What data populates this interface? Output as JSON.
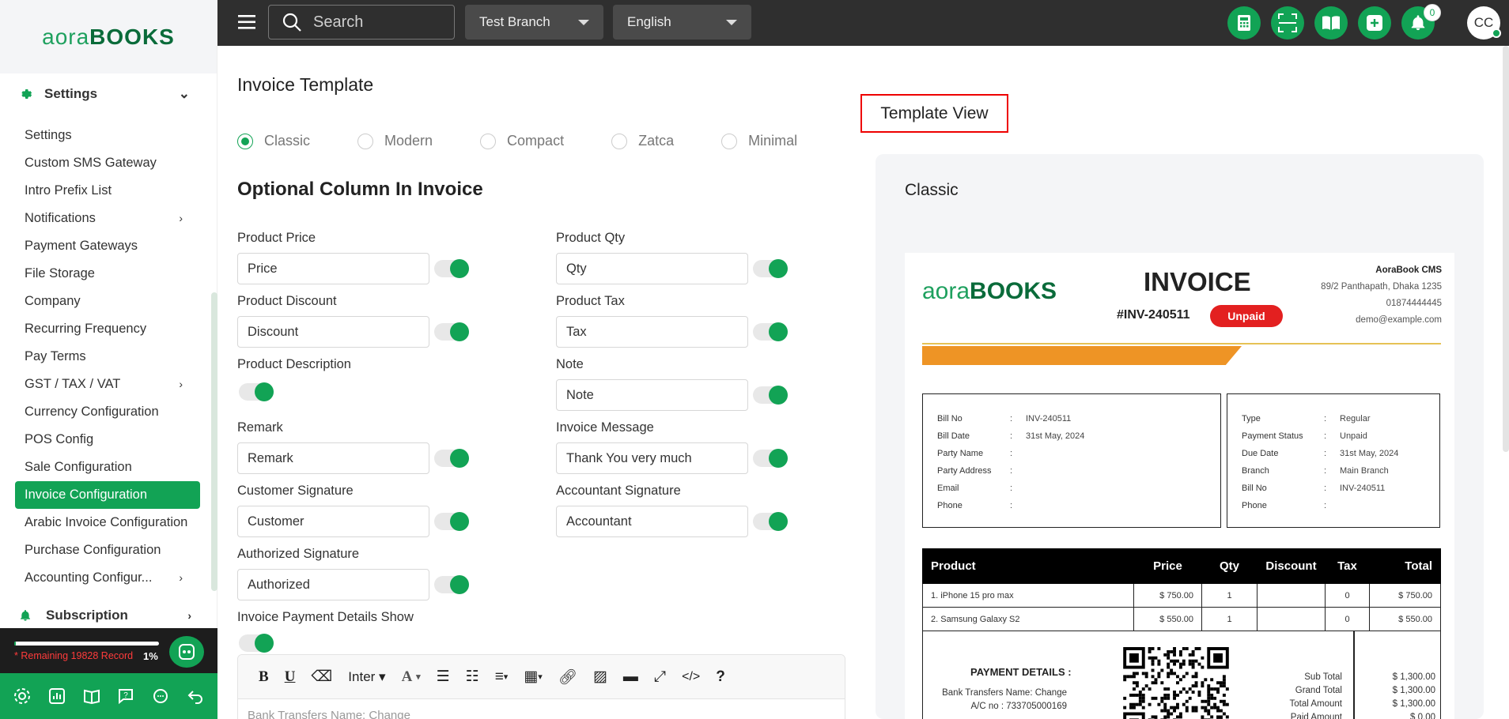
{
  "brand": {
    "name_part1": "aora",
    "name_part2": "BOOKS"
  },
  "sidebar": {
    "settings_header": "Settings",
    "items": [
      {
        "label": "Settings"
      },
      {
        "label": "Custom SMS Gateway"
      },
      {
        "label": "Intro Prefix List"
      },
      {
        "label": "Notifications",
        "has_children": true
      },
      {
        "label": "Payment Gateways"
      },
      {
        "label": "File Storage"
      },
      {
        "label": "Company"
      },
      {
        "label": "Recurring Frequency"
      },
      {
        "label": "Pay Terms"
      },
      {
        "label": "GST / TAX / VAT",
        "has_children": true
      },
      {
        "label": "Currency Configuration"
      },
      {
        "label": "POS Config"
      },
      {
        "label": "Sale Configuration"
      },
      {
        "label": "Invoice Configuration",
        "active": true
      },
      {
        "label": "Arabic Invoice Configuration"
      },
      {
        "label": "Purchase Configuration"
      },
      {
        "label": "Accounting Configur...",
        "has_children": true
      }
    ],
    "subscription_label": "Subscription",
    "remaining_text": "* Remaining 19828 Record",
    "usage_percent": "1%",
    "usage_fraction": 0.01
  },
  "topbar": {
    "search_placeholder": "Search",
    "branch": "Test Branch",
    "language": "English",
    "notification_count": "0",
    "avatar_initials": "CC"
  },
  "main": {
    "title": "Invoice Template",
    "templates": [
      {
        "label": "Classic",
        "selected": true
      },
      {
        "label": "Modern"
      },
      {
        "label": "Compact"
      },
      {
        "label": "Zatca"
      },
      {
        "label": "Minimal"
      }
    ],
    "section_title": "Optional Column In Invoice",
    "fields": {
      "product_price": {
        "label": "Product Price",
        "value": "Price",
        "enabled": true
      },
      "product_qty": {
        "label": "Product Qty",
        "value": "Qty",
        "enabled": true
      },
      "product_discount": {
        "label": "Product Discount",
        "value": "Discount",
        "enabled": true
      },
      "product_tax": {
        "label": "Product Tax",
        "value": "Tax",
        "enabled": true
      },
      "product_description": {
        "label": "Product Description",
        "enabled": true
      },
      "note": {
        "label": "Note",
        "value": "Note",
        "enabled": true
      },
      "remark": {
        "label": "Remark",
        "value": "Remark",
        "enabled": true
      },
      "invoice_message": {
        "label": "Invoice Message",
        "value": "Thank You very much",
        "enabled": true
      },
      "customer_signature": {
        "label": "Customer Signature",
        "value": "Customer",
        "enabled": true
      },
      "accountant_signature": {
        "label": "Accountant Signature",
        "value": "Accountant",
        "enabled": true
      },
      "authorized_signature": {
        "label": "Authorized Signature",
        "value": "Authorized",
        "enabled": true
      },
      "payment_details_show": {
        "label": "Invoice Payment Details Show",
        "enabled": true
      }
    },
    "editor": {
      "font_label": "Inter",
      "body_preview": "Bank Transfers Name: Change"
    }
  },
  "template_view": {
    "label": "Template View",
    "selected_name": "Classic",
    "invoice": {
      "title": "INVOICE",
      "number": "#INV-240511",
      "status": "Unpaid",
      "company": {
        "name": "AoraBook CMS",
        "address": "89/2 Panthapath, Dhaka 1235",
        "phone": "01874444445",
        "email": "demo@example.com"
      },
      "bill_info": [
        {
          "k": "Bill No",
          "v": "INV-240511"
        },
        {
          "k": "Bill Date",
          "v": "31st May, 2024"
        },
        {
          "k": "Party Name",
          "v": ""
        },
        {
          "k": "Party Address",
          "v": ""
        },
        {
          "k": "Email",
          "v": ""
        },
        {
          "k": "Phone",
          "v": ""
        }
      ],
      "type_info": [
        {
          "k": "Type",
          "v": "Regular"
        },
        {
          "k": "Payment Status",
          "v": "Unpaid"
        },
        {
          "k": "Due Date",
          "v": "31st May, 2024"
        },
        {
          "k": "Branch",
          "v": "Main Branch"
        },
        {
          "k": "Bill No",
          "v": "INV-240511"
        },
        {
          "k": "Phone",
          "v": ""
        }
      ],
      "columns": [
        "Product",
        "Price",
        "Qty",
        "Discount",
        "Tax",
        "Total"
      ],
      "rows": [
        {
          "product": "1. iPhone 15 pro max",
          "price": "$ 750.00",
          "qty": "1",
          "discount": "",
          "tax": "0",
          "total": "$ 750.00"
        },
        {
          "product": "2. Samsung Galaxy S2",
          "price": "$ 550.00",
          "qty": "1",
          "discount": "",
          "tax": "0",
          "total": "$ 550.00"
        }
      ],
      "payment_title": "PAYMENT DETAILS :",
      "payment_lines": [
        "Bank Transfers Name: Change",
        "A/C no : 733705000169"
      ],
      "totals": [
        {
          "k": "Sub Total",
          "v": "$ 1,300.00"
        },
        {
          "k": "Grand Total",
          "v": "$ 1,300.00"
        },
        {
          "k": "Total Amount",
          "v": "$ 1,300.00"
        },
        {
          "k": "Paid Amount",
          "v": "$ 0.00"
        }
      ]
    }
  },
  "colors": {
    "accent": "#12a355",
    "topbar": "#2f2f2f",
    "danger": "#e32020",
    "invoice_band": "#ee9425"
  }
}
